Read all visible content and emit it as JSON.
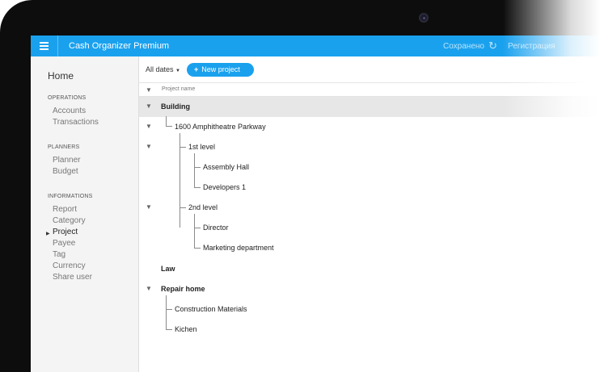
{
  "app": {
    "title": "Cash Organizer Premium",
    "saved_status": "Сохранено",
    "register_label": "Регистрация",
    "icons": {
      "menu": "hamburger-icon",
      "sync": "sync-icon"
    },
    "accent_color": "#1aa1ee"
  },
  "sidebar": {
    "home": "Home",
    "sections": [
      {
        "title": "OPERATIONS",
        "items": [
          "Accounts",
          "Transactions"
        ]
      },
      {
        "title": "PLANNERS",
        "items": [
          "Planner",
          "Budget"
        ]
      },
      {
        "title": "INFORMATIONS",
        "items": [
          "Report",
          "Category",
          "Project",
          "Payee",
          "Tag",
          "Currency",
          "Share user"
        ]
      }
    ],
    "active_item": "Project"
  },
  "toolbar": {
    "filter_label": "All dates",
    "new_project_label": "New project"
  },
  "table": {
    "column_header": "Project name",
    "rows": [
      {
        "label": "Building",
        "bold": true,
        "expanded": true,
        "highlight": true
      },
      {
        "label": "1600 Amphitheatre Parkway",
        "bold": false,
        "expanded": true
      },
      {
        "label": "1st level",
        "bold": false,
        "expanded": true
      },
      {
        "label": "Assembly Hall",
        "bold": false
      },
      {
        "label": "Developers 1",
        "bold": false
      },
      {
        "label": "2nd level",
        "bold": false,
        "expanded": true
      },
      {
        "label": "Director",
        "bold": false
      },
      {
        "label": "Marketing department",
        "bold": false
      },
      {
        "label": "Law",
        "bold": true
      },
      {
        "label": "Repair home",
        "bold": true,
        "expanded": true
      },
      {
        "label": "Construction Materials",
        "bold": false
      },
      {
        "label": "Kichen",
        "bold": false
      }
    ]
  }
}
